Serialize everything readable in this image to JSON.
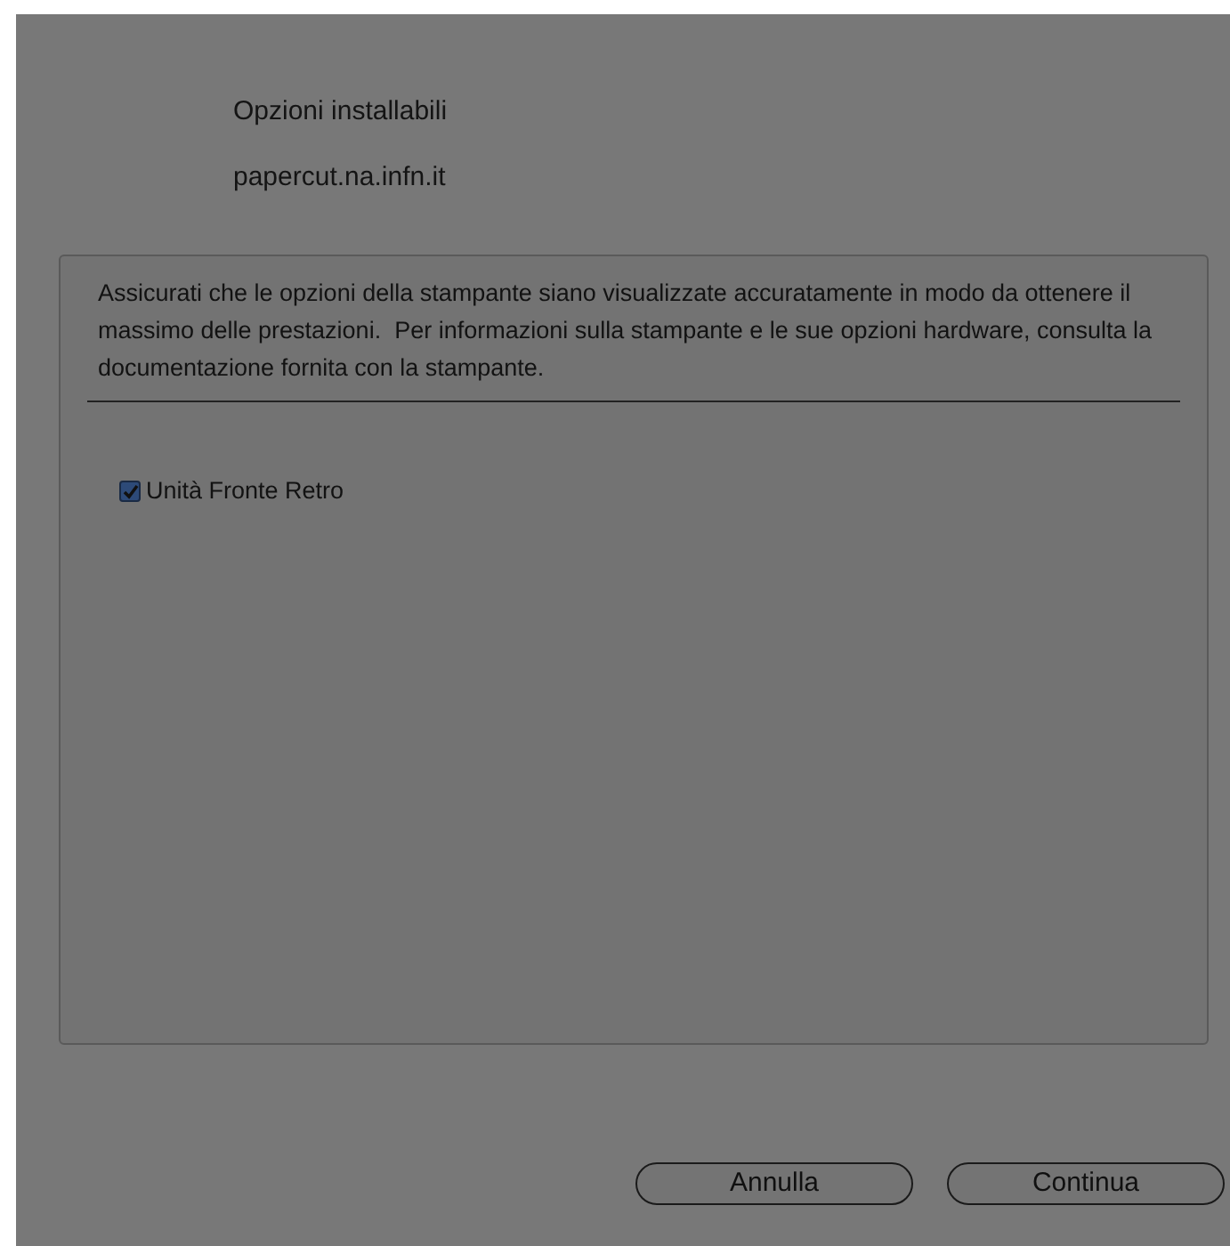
{
  "header": {
    "title": "Opzioni installabili",
    "subtitle": "papercut.na.infn.it"
  },
  "panel": {
    "description": "Assicurati che le opzioni della stampante siano visualizzate accuratamente in modo da ottenere il massimo delle prestazioni.  Per informazioni sulla stampante e le sue opzioni hardware, consulta la documentazione fornita con la stampante.",
    "options": [
      {
        "label": "Unità Fronte Retro",
        "checked": true
      }
    ]
  },
  "buttons": [
    "Annulla",
    "Continua"
  ]
}
